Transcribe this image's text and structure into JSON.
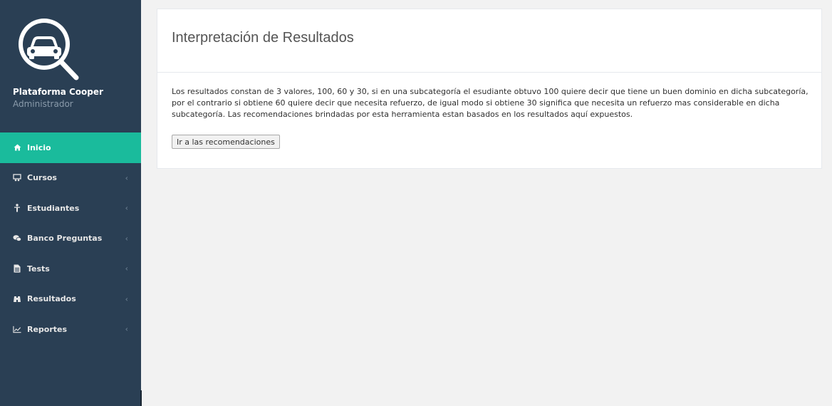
{
  "brand": {
    "name": "Plataforma Cooper",
    "role": "Administrador"
  },
  "menu": [
    {
      "label": "Inicio",
      "icon": "home-icon",
      "active": true
    },
    {
      "label": "Cursos",
      "icon": "courses-icon"
    },
    {
      "label": "Estudiantes",
      "icon": "student-icon"
    },
    {
      "label": "Banco Preguntas",
      "icon": "comments-icon"
    },
    {
      "label": "Tests",
      "icon": "file-icon"
    },
    {
      "label": "Resultados",
      "icon": "binoculars-icon"
    },
    {
      "label": "Reportes",
      "icon": "line-chart-icon"
    }
  ],
  "chevron": "‹",
  "panel": {
    "title": "Interpretación de Resultados",
    "text": "Los resultados constan de 3 valores, 100, 60 y 30, si en una subcategoría el esudiante obtuvo 100 quiere decir que tiene un buen dominio en dicha subcategoría, por el contrario si obtiene 60 quiere decir que necesita refuerzo, de igual modo si obtiene 30 significa que necesita un refuerzo mas considerable en dicha subcategoría. Las recomendaciones brindadas por esta herramienta estan basados en los resultados aquí expuestos.",
    "button_label": "Ir a las recomendaciones"
  },
  "colors": {
    "sidebar": "#2a3f54",
    "active": "#1abb9c",
    "background": "#f2f2f2"
  }
}
